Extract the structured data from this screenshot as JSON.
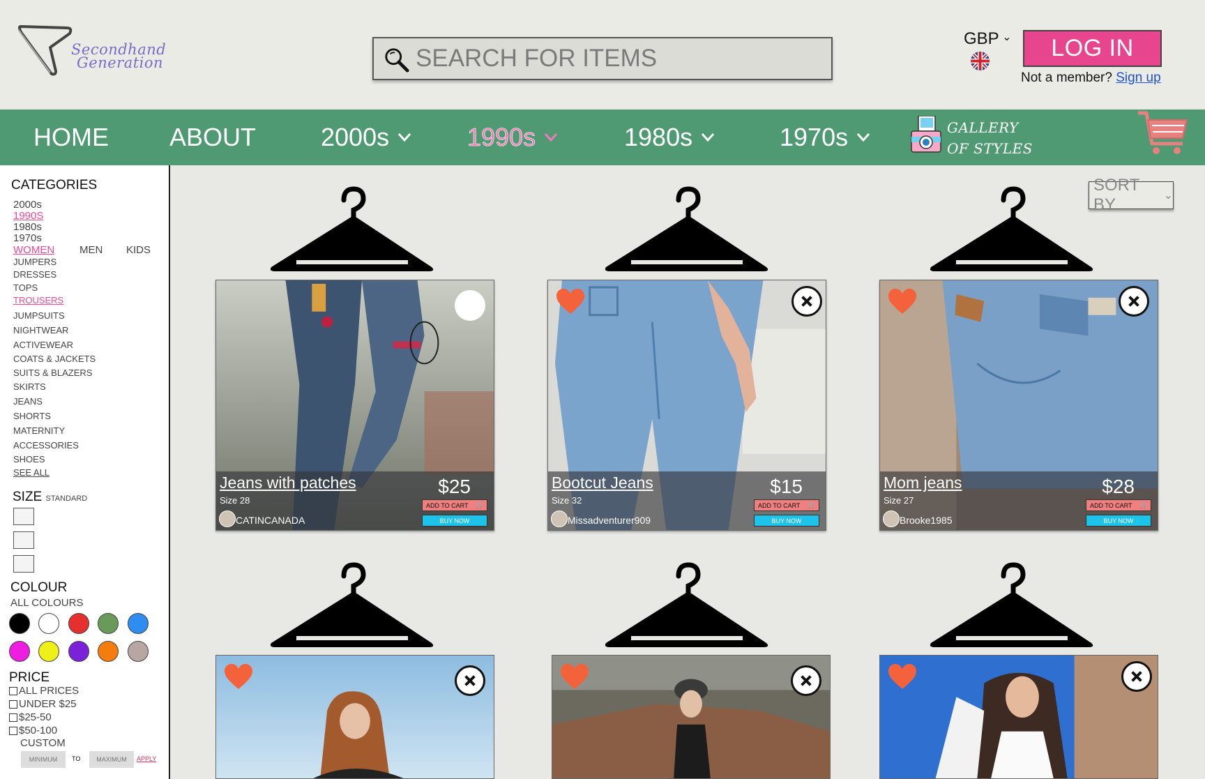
{
  "brand": {
    "line1": "Secondhand",
    "line2": "Generation"
  },
  "search": {
    "placeholder": "SEARCH FOR ITEMS"
  },
  "currency": {
    "code": "GBP",
    "flag": "uk-flag-icon"
  },
  "auth": {
    "login_label": "LOG IN",
    "member_text": "Not a member?",
    "signup_label": "Sign up"
  },
  "nav": {
    "items": [
      {
        "label": "HOME"
      },
      {
        "label": "ABOUT"
      },
      {
        "label": "2000s"
      },
      {
        "label": "1990s",
        "active": true
      },
      {
        "label": "1980s"
      },
      {
        "label": "1970s"
      }
    ],
    "gallery_line1": "GALLERY",
    "gallery_line2": "OF STYLES"
  },
  "sidebar": {
    "categories_title": "CATEGORIES",
    "eras": [
      "2000s",
      "1990S",
      "1980s",
      "1970s"
    ],
    "audiences": [
      "WOMEN",
      "MEN",
      "KIDS"
    ],
    "categories": [
      "JUMPERS",
      "DRESSES",
      "TOPS",
      "TROUSERS",
      "JUMPSUITS",
      "NIGHTWEAR",
      "ACTIVEWEAR",
      "COATS & JACKETS",
      "SUITS & BLAZERS",
      "SKIRTS",
      "JEANS",
      "SHORTS",
      "MATERNITY",
      "ACCESSORIES",
      "SHOES",
      "SEE ALL"
    ],
    "size_title": "SIZE",
    "size_sub": "STANDARD",
    "colour_title": "COLOUR",
    "colour_sub": "ALL COLOURS",
    "colours": [
      "#000000",
      "#ffffff",
      "#e53030",
      "#6a9a5a",
      "#2f8cf0",
      "#ee1ee0",
      "#eef018",
      "#7a22d8",
      "#f57d10",
      "#b8a6a2"
    ],
    "price_title": "PRICE",
    "price_options": [
      "ALL PRICES",
      "UNDER $25",
      "$25-50",
      "$50-100"
    ],
    "custom_label": "CUSTOM",
    "min_placeholder": "MINIMUM",
    "to_label": "TO",
    "max_placeholder": "MAXIMUM",
    "apply_label": "APPLY"
  },
  "sort": {
    "label": "SORT BY"
  },
  "products": [
    {
      "title": "Jeans with patches",
      "size": "Size 28",
      "price": "$25",
      "seller": "CATINCANADA",
      "cart_label": "ADD TO CART",
      "buy_label": "BUY NOW"
    },
    {
      "title": "Bootcut Jeans",
      "size": "Size 32",
      "price": "$15",
      "seller": "Missadventurer909",
      "cart_label": "ADD TO CART",
      "buy_label": "BUY NOW"
    },
    {
      "title": "Mom jeans",
      "size": "Size 27",
      "price": "$28",
      "seller": "Brooke1985",
      "cart_label": "ADD TO CART",
      "buy_label": "BUY NOW"
    }
  ],
  "colors": {
    "nav_green": "#4f9a72",
    "accent_pink": "#e7468f",
    "buy_cyan": "#1ec3ea",
    "cart_coral": "#f07f7f"
  }
}
